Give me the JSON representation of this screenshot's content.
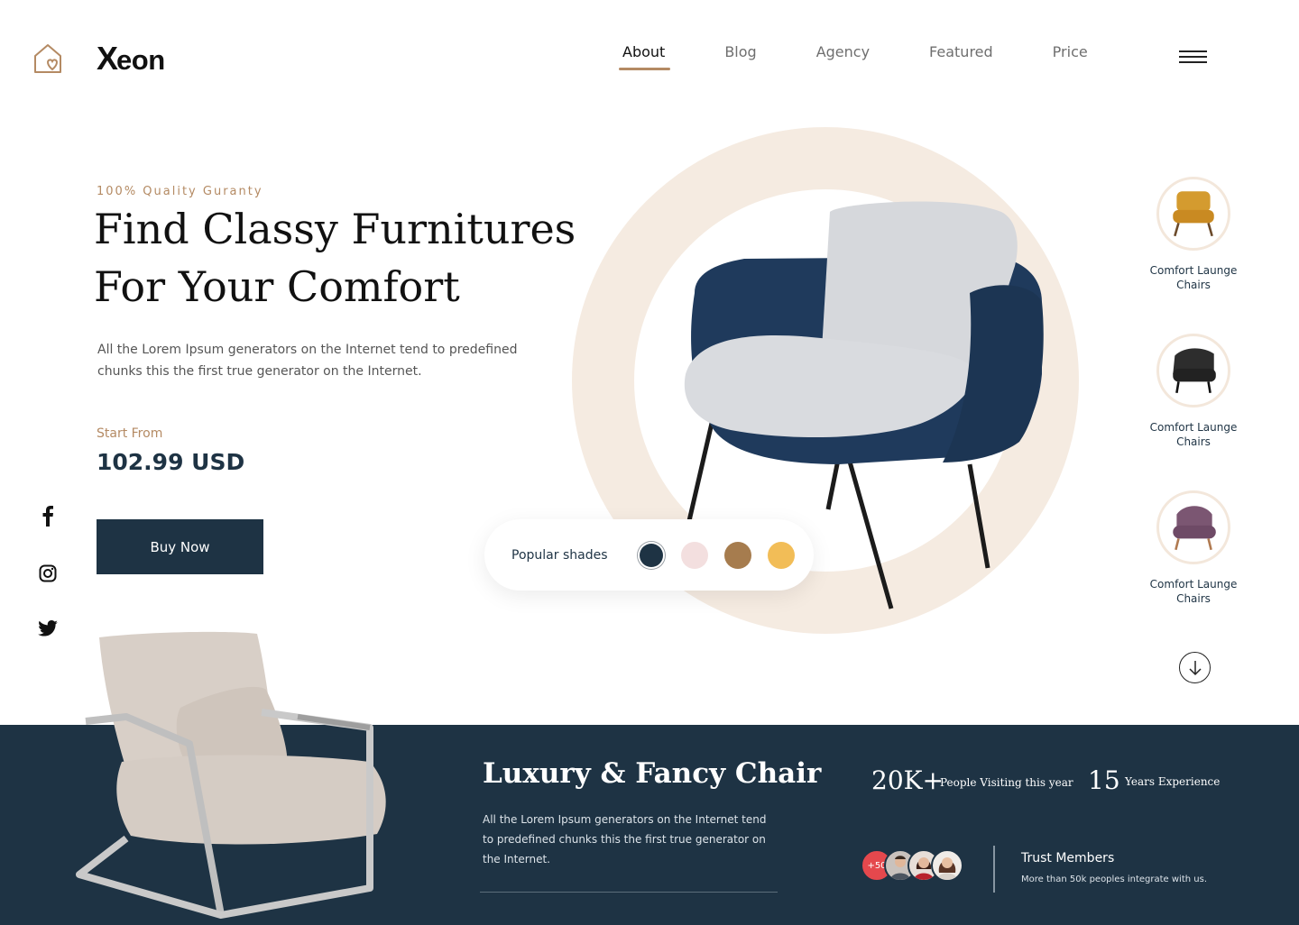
{
  "header": {
    "brand_mark": "X",
    "brand_rest": "eon",
    "nav": [
      {
        "label": "About",
        "active": true
      },
      {
        "label": "Blog",
        "active": false
      },
      {
        "label": "Agency",
        "active": false
      },
      {
        "label": "Featured",
        "active": false
      },
      {
        "label": "Price",
        "active": false
      }
    ]
  },
  "hero": {
    "tagline": "100% Quality Guranty",
    "title_line1": "Find Classy Furnitures",
    "title_line2": "For Your Comfort",
    "description": "All the Lorem Ipsum generators on the Internet tend to predefined chunks  this the first true generator on the Internet.",
    "price_label": "Start From",
    "price": "102.99 USD",
    "cta": "Buy Now"
  },
  "shades": {
    "label": "Popular shades",
    "colors": [
      "#1e3344",
      "#f3dfdf",
      "#a67c4e",
      "#f2bd57"
    ],
    "selected_index": 0
  },
  "products": [
    {
      "label": "Comfort Launge Chairs",
      "color": "#d49b2f",
      "icon": "mustard-chair-icon"
    },
    {
      "label": "Comfort Launge Chairs",
      "color": "#2d2d2d",
      "icon": "black-chair-icon"
    },
    {
      "label": "Comfort Launge Chairs",
      "color": "#7b5672",
      "icon": "purple-chair-icon"
    }
  ],
  "social": [
    "facebook-icon",
    "instagram-icon",
    "twitter-icon"
  ],
  "feature": {
    "title": "Luxury & Fancy Chair",
    "description": "All the Lorem Ipsum generators on the Internet tend to predefined chunks  this the first true generator on the Internet."
  },
  "stats": [
    {
      "value": "20K+",
      "label": "People Visiting this year"
    },
    {
      "value": "15",
      "label": "Years Experience"
    }
  ],
  "trust": {
    "badge": "+50",
    "title": "Trust Members",
    "description": "More than 50k peoples integrate with us."
  },
  "colors": {
    "navy": "#1e3344",
    "accent": "#b48a63",
    "ring": "#f5ebe1"
  }
}
